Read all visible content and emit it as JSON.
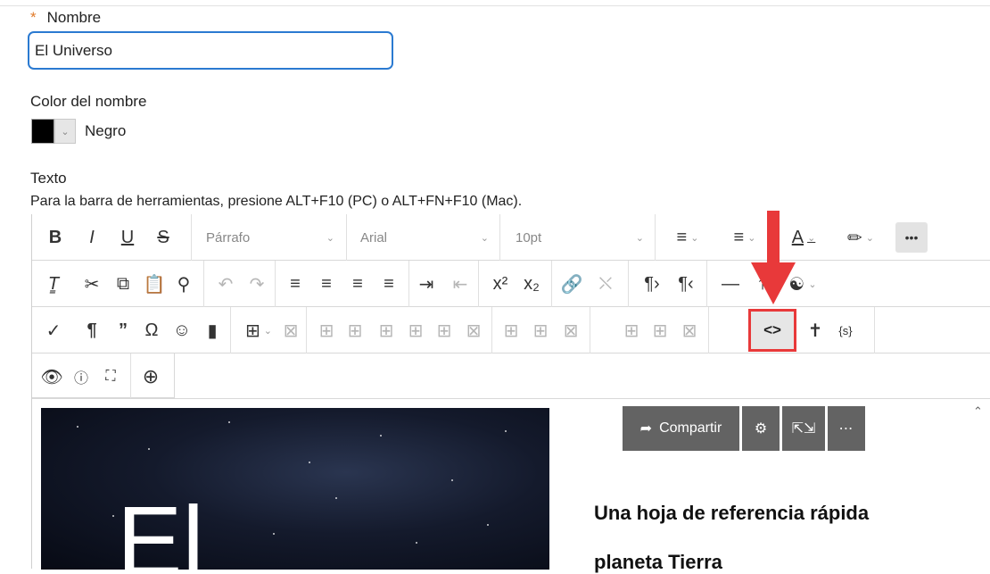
{
  "name_field": {
    "label": "Nombre",
    "required_mark": "*",
    "value": "El Universo"
  },
  "color_field": {
    "label": "Color del nombre",
    "swatch_color": "#000000",
    "value": "Negro"
  },
  "text_field": {
    "label": "Texto",
    "toolbar_hint": "Para la barra de herramientas, presione ALT+F10 (PC) o ALT+FN+F10 (Mac)."
  },
  "toolbar": {
    "paragraph_select": "Párrafo",
    "font_select": "Arial",
    "size_select": "10pt"
  },
  "content": {
    "image_title": "El",
    "share_label": "Compartir",
    "heading_line1": "Una hoja de referencia rápida",
    "heading_line2": "planeta Tierra"
  },
  "colors": {
    "accent": "#2b7ad1",
    "highlight": "#e8393a",
    "required": "#e07a2a"
  }
}
